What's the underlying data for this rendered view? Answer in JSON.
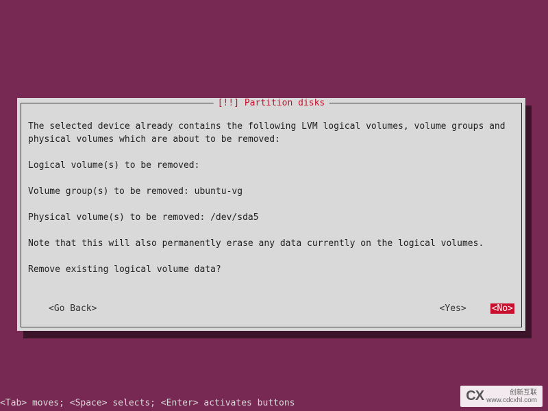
{
  "dialog": {
    "title": "[!!] Partition disks",
    "intro": "The selected device already contains the following LVM logical volumes, volume groups and physical volumes which are about to be removed:",
    "logical_line": "Logical volume(s) to be removed:",
    "vg_line": "Volume group(s) to be removed: ubuntu-vg",
    "pv_line": "Physical volume(s) to be removed: /dev/sda5",
    "note": "Note that this will also permanently erase any data currently on the logical volumes.",
    "question": "Remove existing logical volume data?",
    "go_back": "<Go Back>",
    "yes": "<Yes>",
    "no": "<No>"
  },
  "hint": "<Tab> moves; <Space> selects; <Enter> activates buttons",
  "watermark": {
    "logo": "CX",
    "line1": "创新互联",
    "line2": "www.cdcxhl.com"
  },
  "colors": {
    "background": "#772953",
    "panel": "#d9d9d9",
    "accent": "#c8102e"
  }
}
